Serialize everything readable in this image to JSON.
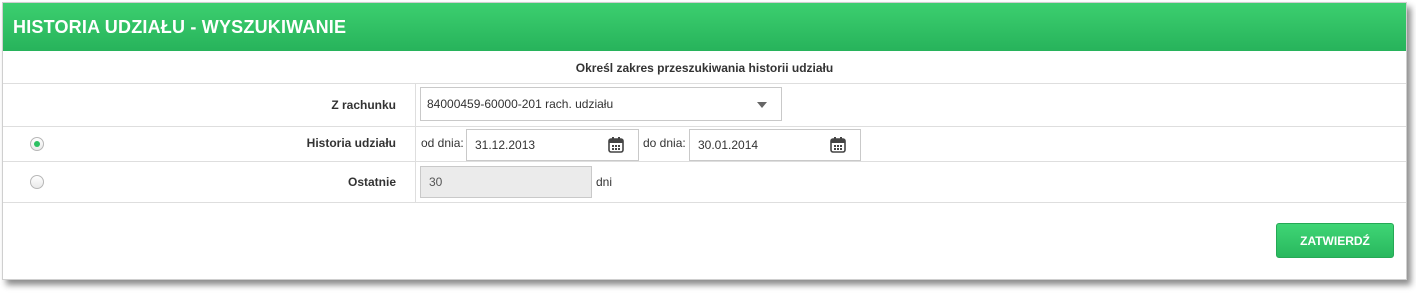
{
  "header": {
    "title": "HISTORIA UDZIAŁU - WYSZUKIWANIE"
  },
  "form": {
    "caption": "Określ zakres przeszukiwania historii udziału",
    "account": {
      "label": "Z rachunku",
      "selected_value": "84000459-60000-201  rach. udziału"
    },
    "history": {
      "label": "Historia udziału",
      "radio_selected": true,
      "from_label": "od dnia:",
      "from_value": "31.12.2013",
      "to_label": "do dnia:",
      "to_value": "30.01.2014"
    },
    "last": {
      "label": "Ostatnie",
      "radio_selected": false,
      "value": "30",
      "unit": "dni"
    },
    "submit_label": "ZATWIERDŹ"
  },
  "colors": {
    "accent": "#2cc062",
    "header_bg": "#27b35b"
  },
  "icons": {
    "calendar": "calendar-icon",
    "dropdown": "chevron-down-icon"
  }
}
